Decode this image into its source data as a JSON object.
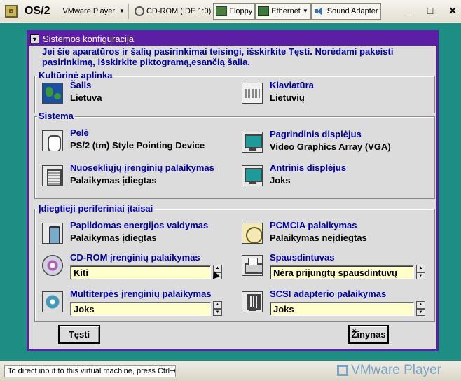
{
  "vmware": {
    "app_title": "OS/2",
    "menu_label": "VMware Player",
    "devices": [
      {
        "label": "CD-ROM (IDE 1:0)",
        "icon": "cdrom-icon"
      },
      {
        "label": "Floppy",
        "icon": "floppy-icon"
      },
      {
        "label": "Ethernet",
        "icon": "ethernet-icon"
      },
      {
        "label": "Sound Adapter",
        "icon": "sound-icon"
      }
    ],
    "window_buttons": {
      "minimize": "_",
      "maximize": "□",
      "close": "✕"
    },
    "status_text": "To direct input to this virtual machine, press Ctrl+G.",
    "brand": "VMware Player"
  },
  "dialog": {
    "title": "Sistemos konfigūracija",
    "info": "Jei šie aparatūros ir šalių pasirinkimai teisingi, išskirkite Tęsti. Norėdami pakeisti pasirinkimą, išskirkite piktogramą,esančią šalia.",
    "groups": {
      "culture": {
        "label": "Kultūrinė aplinka",
        "items": [
          {
            "label": "Šalis",
            "value": "Lietuva"
          },
          {
            "label": "Klaviatūra",
            "value": "Lietuvių"
          }
        ]
      },
      "system": {
        "label": "Sistema",
        "items": [
          {
            "label": "Pelė",
            "value": "PS/2 (tm) Style Pointing Device"
          },
          {
            "label": "Pagrindinis displėjus",
            "value": "Video Graphics Array (VGA)"
          },
          {
            "label": "Nuosekliųjų įrenginių palaikymas",
            "value": "Palaikymas įdiegtas"
          },
          {
            "label": "Antrinis displėjus",
            "value": "Joks"
          }
        ]
      },
      "peripherals": {
        "label": "Įdiegtieji periferiniai įtaisai",
        "items": [
          {
            "label": "Papildomas energijos valdymas",
            "value": "Palaikymas įdiegtas"
          },
          {
            "label": "PCMCIA palaikymas",
            "value": "Palaikymas neįdiegtas"
          },
          {
            "label": "CD-ROM įrenginių palaikymas",
            "value": "Kiti"
          },
          {
            "label": "Spausdintuvas",
            "value": "Nėra prijungtų spausdintuvų"
          },
          {
            "label": "Multiterpės įrenginių palaikymas",
            "value": "Joks"
          },
          {
            "label": "SCSI adapterio palaikymas",
            "value": "Joks"
          }
        ]
      }
    },
    "buttons": {
      "continue": "Tęsti",
      "help": "Žinynas"
    },
    "colors": {
      "title_bar": "#5d1ea6",
      "desktop": "#1e8e84",
      "label_text": "#0000a8",
      "combo_field": "#ffffcc"
    }
  }
}
